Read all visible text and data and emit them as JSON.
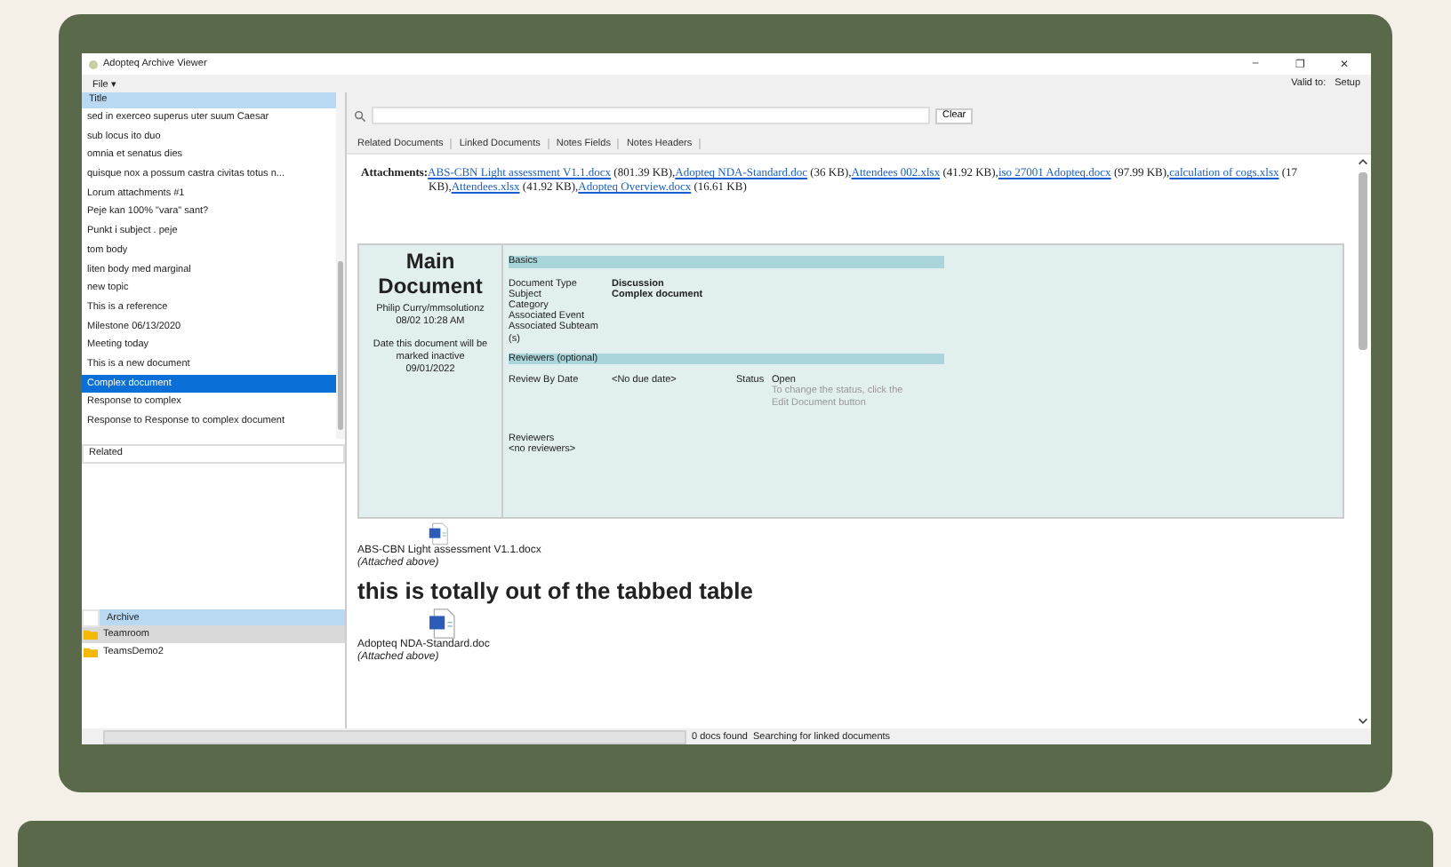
{
  "window": {
    "title": "Adopteq Archive Viewer",
    "controls": [
      "–",
      "❐",
      "✕"
    ]
  },
  "menu": {
    "file": "File ▾",
    "valid_to": "Valid to:",
    "setup": "Setup"
  },
  "documents": {
    "header": "Title",
    "rows": [
      {
        "title": "sed in exerceo superus uter suum Caesar",
        "selected": false
      },
      {
        "title": "sub locus ito duo",
        "selected": false
      },
      {
        "title": "omnia et senatus dies",
        "selected": false
      },
      {
        "title": "quisque nox a possum castra civitas totus n...",
        "selected": false
      },
      {
        "title": "Lorum attachments #1",
        "selected": false
      },
      {
        "title": "Peje kan 100% \"vara\" sant?",
        "selected": false
      },
      {
        "title": "Punkt i subject . peje",
        "selected": false
      },
      {
        "title": "tom body",
        "selected": false
      },
      {
        "title": "liten body med marginal",
        "selected": false
      },
      {
        "title": "new topic",
        "selected": false
      },
      {
        "title": "This is a reference",
        "selected": false
      },
      {
        "title": "Milestone  06/13/2020",
        "selected": false
      },
      {
        "title": "Meeting today",
        "selected": false
      },
      {
        "title": "This is a new document",
        "selected": false
      },
      {
        "title": "Complex document",
        "selected": true
      },
      {
        "title": "Response to complex",
        "selected": false
      },
      {
        "title": "Response to Response to complex document",
        "selected": false
      }
    ]
  },
  "related": {
    "header": "Related"
  },
  "archive": {
    "header": "Archive",
    "checked": false,
    "items": [
      {
        "label": "Teamroom",
        "selected": true
      },
      {
        "label": "TeamsDemo2",
        "selected": false
      }
    ]
  },
  "search": {
    "clear": "Clear"
  },
  "tabs": [
    {
      "label": "Related Documents"
    },
    {
      "label": "Linked Documents"
    },
    {
      "label": "Notes Fields"
    },
    {
      "label": "Notes Headers"
    }
  ],
  "attachments": {
    "label": "Attachments:",
    "items": [
      {
        "name": "ABS-CBN Light assessment V1.1.docx",
        "size": "(801.39 KB),"
      },
      {
        "name": "Adopteq NDA-Standard.doc",
        "size": "(36 KB),"
      },
      {
        "name": "Attendees 002.xlsx",
        "size": "(41.92 KB),"
      },
      {
        "name": "iso 27001 Adopteq.docx",
        "size": "(97.99 KB),"
      },
      {
        "name": "calculation of cogs.xlsx",
        "size": "(17 KB),"
      },
      {
        "name": "Attendees.xlsx",
        "size": "(41.92 KB),"
      },
      {
        "name": "Adopteq Overview.docx",
        "size": "(16.61 KB)"
      }
    ]
  },
  "main_document": {
    "title": "Main Document",
    "author": "Philip Curry/mmsolutionz",
    "date": "08/02 10:28 AM",
    "inactive_note": "Date this document will be marked inactive",
    "inactive_date": "09/01/2022",
    "basics_header": "Basics",
    "fields": [
      {
        "label": "Document Type",
        "value": "Discussion"
      },
      {
        "label": "Subject",
        "value": "Complex document"
      },
      {
        "label": "Category"
      },
      {
        "label": "Associated Event"
      },
      {
        "label": "Associated Subteam (s)"
      }
    ],
    "reviewers_header": "Reviewers (optional)",
    "review_by_label": "Review By Date",
    "review_by_value": "<No due date>",
    "status_label": "Status",
    "status_value": "Open",
    "status_hint": "To change the status, click the Edit Document button",
    "reviewers_label": "Reviewers",
    "reviewers_value": "<no reviewers>"
  },
  "attached_files": [
    {
      "name": "ABS-CBN Light assessment V1.1.docx",
      "note": "(Attached above)"
    }
  ],
  "heading": "this is totally out of the tabbed table",
  "attached_files_2": [
    {
      "name": "Adopteq NDA-Standard.doc",
      "note": "(Attached above)"
    }
  ],
  "status_bar": {
    "level": 0,
    "count": "0 docs found",
    "message": "Searching for linked documents"
  }
}
